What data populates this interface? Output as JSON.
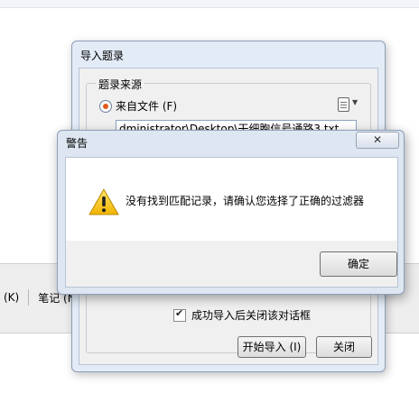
{
  "background": {
    "toolbar_items": [
      "(K)",
      "笔记 (N"
    ]
  },
  "import_dialog": {
    "title": "导入题录",
    "group_label": "题录来源",
    "from_file_label": "来自文件 (F)",
    "file_path": "dministrator\\Desktop\\干细胞信号通路3.txt ...",
    "close_on_success_label": "成功导入后关闭该对话框",
    "close_on_success_checked": true,
    "start_import_button": "开始导入 (I)",
    "close_button": "关闭"
  },
  "warning_dialog": {
    "title": "警告",
    "close_glyph": "✕",
    "message": "没有找到匹配记录，请确认您选择了正确的过滤器",
    "ok_button": "确定"
  },
  "colors": {
    "accent_orange": "#e05a1a",
    "warning_yellow": "#f5c400",
    "dialog_frame": "#dde6f1"
  }
}
